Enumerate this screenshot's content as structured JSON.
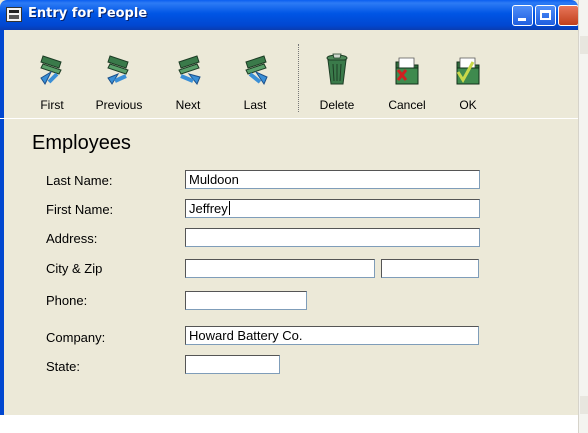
{
  "window": {
    "title": "Entry for People",
    "icon": "app-form-icon"
  },
  "toolbar": {
    "buttons": [
      {
        "label": "First",
        "icon": "first-record-icon"
      },
      {
        "label": "Previous",
        "icon": "previous-record-icon"
      },
      {
        "label": "Next",
        "icon": "next-record-icon"
      },
      {
        "label": "Last",
        "icon": "last-record-icon"
      },
      {
        "label": "Delete",
        "icon": "trash-icon"
      },
      {
        "label": "Cancel",
        "icon": "cancel-folder-icon"
      },
      {
        "label": "OK",
        "icon": "ok-folder-icon"
      }
    ]
  },
  "form": {
    "heading": "Employees",
    "last_name": {
      "label": "Last Name:",
      "value": "Muldoon"
    },
    "first_name": {
      "label": "First Name:",
      "value": "Jeffrey"
    },
    "address": {
      "label": "Address:",
      "value": ""
    },
    "city_zip": {
      "label": "City & Zip",
      "city": "",
      "zip": ""
    },
    "phone": {
      "label": "Phone:",
      "value": ""
    },
    "company": {
      "label": "Company:",
      "value": "Howard Battery Co."
    },
    "state": {
      "label": "State:",
      "value": ""
    }
  },
  "colors": {
    "titlebar": "#0055e5",
    "face": "#ece9d8",
    "folder_green": "#2e6b3a",
    "arrow_blue": "#3a8fd6"
  }
}
